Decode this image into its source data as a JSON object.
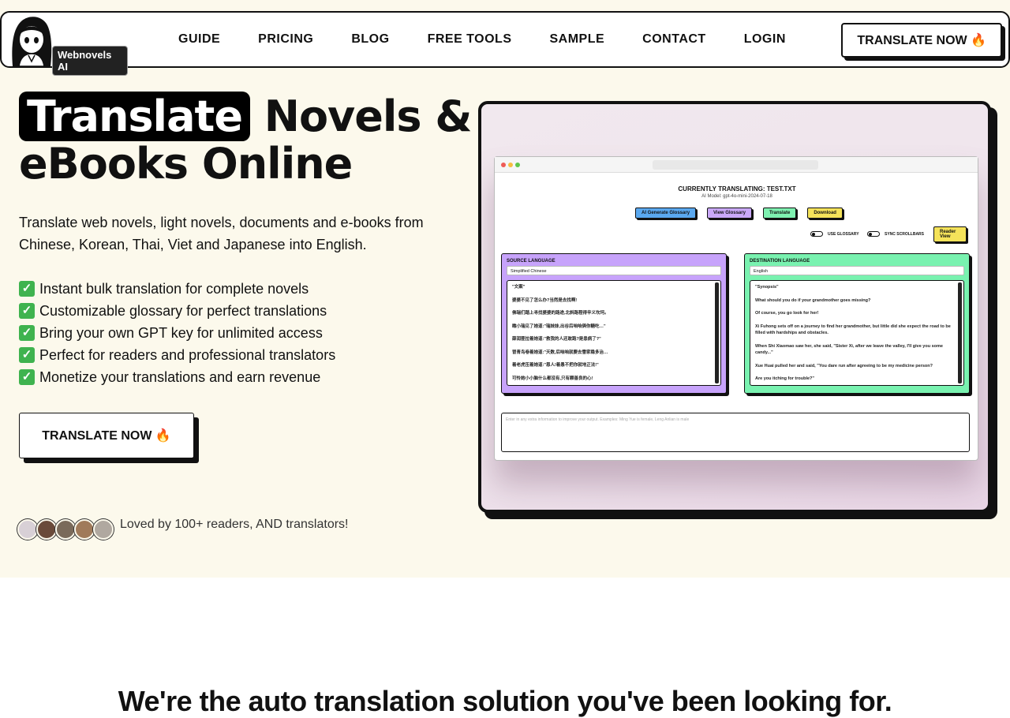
{
  "nav": {
    "logo_text": "Webnovels AI",
    "links": [
      "GUIDE",
      "PRICING",
      "BLOG",
      "FREE TOOLS",
      "SAMPLE",
      "CONTACT",
      "LOGIN"
    ],
    "cta": "TRANSLATE NOW 🔥"
  },
  "hero": {
    "title_highlight": "Translate",
    "title_rest_1": "Novels &",
    "title_rest_2": "eBooks Online",
    "subtitle": "Translate web novels, light novels, documents and e-books from Chinese, Korean, Thai, Viet and Japanese into English.",
    "features": [
      "Instant bulk translation for complete novels",
      "Customizable glossary for perfect translations",
      "Bring your own GPT key for unlimited access",
      "Perfect for readers and professional translators",
      "Monetize your translations and earn revenue"
    ],
    "cta": "TRANSLATE NOW 🔥",
    "social_proof": "Loved by 100+ readers, AND translators!"
  },
  "screenshot": {
    "title": "CURRENTLY TRANSLATING: TEST.TXT",
    "model": "AI Model: gpt-4o-mini-2024-07-18",
    "buttons": [
      "AI Generate Glossary",
      "View Glossary",
      "Translate",
      "Download"
    ],
    "toggle_glossary": "USE GLOSSARY",
    "toggle_scroll": "SYNC SCROLLBARS",
    "reader_view": "Reader View",
    "source": {
      "label": "SOURCE LANGUAGE",
      "language": "Simplified Chinese",
      "lines": [
        "\"文案\"",
        "婆婆不见了怎么办?当然是去找啊!",
        "佛瑞们踏上寻找婆婆的路途,北斜路程得辛义坎坷。",
        "瞧小瑞见了她道:\"瑞妹妹,出谷后咱咱俩你糖吃…\"",
        "薛润匪拉着她道:\"救我的人还敢跑?是患病了?\"",
        "冒青鸟卷着她道:\"天数,后咱咱就要去雪家稳多治…",
        "着老虎压着她道:\"恩人!着愚不把你就地正法!\"",
        "可怜她小小脑什么都没有,只有颗善良的心!"
      ]
    },
    "destination": {
      "label": "DESTINATION LANGUAGE",
      "language": "English",
      "lines": [
        "\"Synopsis\"",
        "What should you do if your grandmother goes missing?",
        "Of course, you go look for her!",
        "Xi Fuhong sets off on a journey to find her grandmother, but little did she expect the road to be filled with hardships and obstacles.",
        "When Shi Xiaomao saw her, she said, \"Sister Xi, after we leave the valley, I'll give you some candy...\"",
        "Xue Huai pulled her and said, \"You dare run after agreeing to be my medicine person?",
        "Are you itching for trouble?\""
      ]
    },
    "extra_placeholder": "Enter in any extra information to improve your output. Examples: Ming Yue is female, Leng Anlian is male"
  },
  "section2": {
    "heading": "We're the auto translation solution you've been looking for."
  },
  "colors": {
    "hero_bg": "#fcf9ec",
    "btn_glossary": "#5aa8ef",
    "btn_view": "#c9a8f7",
    "btn_translate": "#7ef0b0",
    "btn_download": "#f5e35a",
    "source_panel": "#c7a3fb",
    "dest_panel": "#79f2b0"
  }
}
